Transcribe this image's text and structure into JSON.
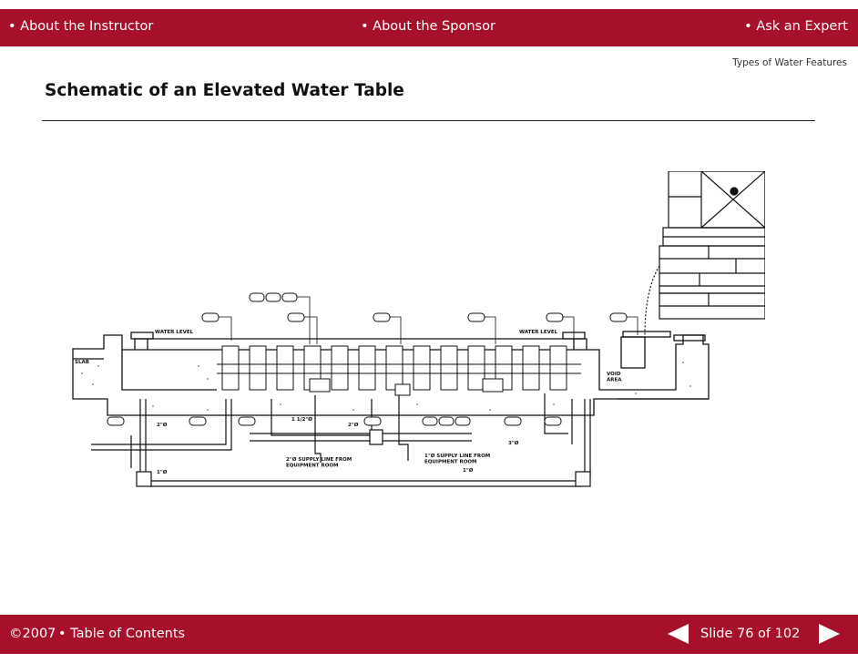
{
  "header": {
    "links": [
      {
        "label": "• About the Instructor"
      },
      {
        "label": "• About the Sponsor"
      },
      {
        "label": "• Ask an Expert"
      }
    ]
  },
  "section_label": "Types of Water Features",
  "slide_title": "Schematic of an Elevated Water Table",
  "schematic": {
    "labels": {
      "water_level_left": "WATER LEVEL",
      "water_level_right": "WATER LEVEL",
      "slab": "SLAB",
      "void_area": "VOID\nAREA",
      "supply_line_a": "2\"Ø SUPPLY LINE FROM\nEQUIPMENT ROOM",
      "supply_line_b": "1\"Ø SUPPLY LINE FROM\nEQUIPMENT ROOM",
      "dim_a": "2\"Ø",
      "dim_b": "1 1/2\"Ø",
      "dim_c": "2\"Ø",
      "dim_d": "3\"Ø",
      "dim_e": "1\"Ø",
      "dim_f": "1\"Ø"
    }
  },
  "footer": {
    "copyright": "©2007",
    "toc_label": "• Table of Contents",
    "slide_counter": "Slide 76 of 102"
  },
  "colors": {
    "brand": "#a6102a"
  }
}
